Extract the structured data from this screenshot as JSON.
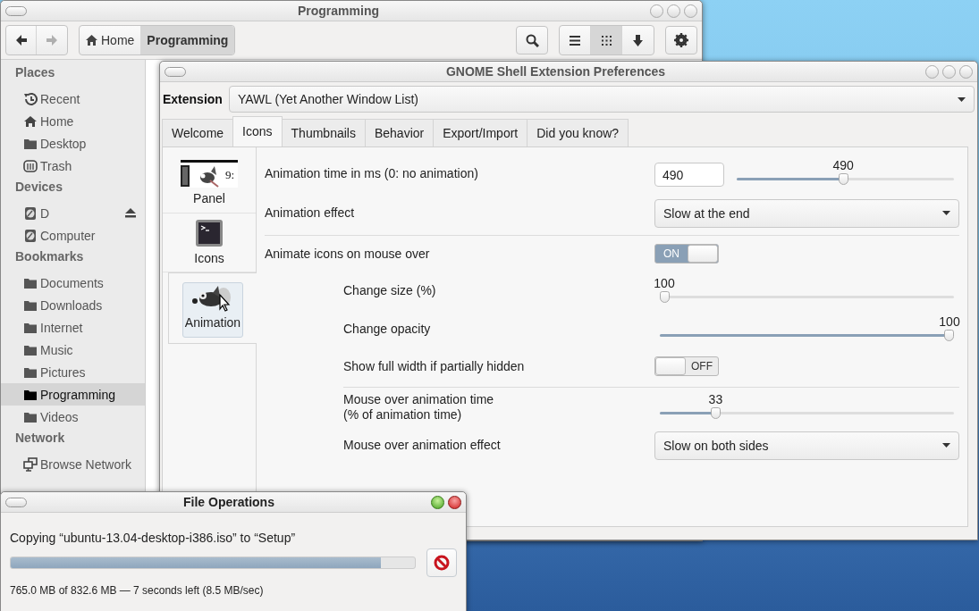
{
  "file_manager": {
    "title": "Programming",
    "nav": [
      {
        "kind": "back",
        "disabled": false
      },
      {
        "kind": "forward",
        "disabled": true
      }
    ],
    "breadcrumbs": [
      {
        "label": "Home",
        "kind": "home",
        "selected": false
      },
      {
        "label": "Programming",
        "kind": "plain",
        "selected": true
      }
    ],
    "views": [
      {
        "kind": "list",
        "selected": false
      },
      {
        "kind": "grid",
        "selected": true
      },
      {
        "kind": "sort",
        "selected": false
      }
    ],
    "sidebar": [
      {
        "heading": "Places",
        "items": [
          {
            "label": "Recent",
            "kind": "recent",
            "selected": false,
            "ejectable": false
          },
          {
            "label": "Home",
            "kind": "home",
            "selected": false,
            "ejectable": false
          },
          {
            "label": "Desktop",
            "kind": "folder",
            "selected": false,
            "ejectable": false
          },
          {
            "label": "Trash",
            "kind": "trash",
            "selected": false,
            "ejectable": false
          }
        ]
      },
      {
        "heading": "Devices",
        "items": [
          {
            "label": "D",
            "kind": "drive",
            "selected": false,
            "ejectable": true
          },
          {
            "label": "Computer",
            "kind": "drive",
            "selected": false,
            "ejectable": false
          }
        ]
      },
      {
        "heading": "Bookmarks",
        "items": [
          {
            "label": "Documents",
            "kind": "folder",
            "selected": false,
            "ejectable": false
          },
          {
            "label": "Downloads",
            "kind": "folder",
            "selected": false,
            "ejectable": false
          },
          {
            "label": "Internet",
            "kind": "folder",
            "selected": false,
            "ejectable": false
          },
          {
            "label": "Music",
            "kind": "folder",
            "selected": false,
            "ejectable": false
          },
          {
            "label": "Pictures",
            "kind": "folder",
            "selected": false,
            "ejectable": false
          },
          {
            "label": "Programming",
            "kind": "folder",
            "selected": true,
            "ejectable": false
          },
          {
            "label": "Videos",
            "kind": "folder",
            "selected": false,
            "ejectable": false
          }
        ]
      },
      {
        "heading": "Network",
        "items": [
          {
            "label": "Browse Network",
            "kind": "network",
            "selected": false,
            "ejectable": false
          }
        ]
      }
    ]
  },
  "preferences": {
    "title": "GNOME Shell Extension Preferences",
    "extension_label": "Extension",
    "extension": "YAWL (Yet Another Window List)",
    "tabs": [
      {
        "label": "Welcome",
        "selected": false
      },
      {
        "label": "Icons",
        "selected": true
      },
      {
        "label": "Thumbnails",
        "selected": false
      },
      {
        "label": "Behavior",
        "selected": false
      },
      {
        "label": "Export/Import",
        "selected": false
      },
      {
        "label": "Did you know?",
        "selected": false
      }
    ],
    "side_tabs": [
      {
        "label": "Panel",
        "kind": "panel",
        "preview_text": "9:",
        "selected": false
      },
      {
        "label": "Icons",
        "kind": "terminal",
        "selected": false
      },
      {
        "label": "Animation",
        "kind": "animation",
        "selected": true
      }
    ],
    "settings": [
      {
        "kind": "spin_slider",
        "label": "Animation time in ms (0: no animation)",
        "value": "490",
        "reading": "490",
        "level": 0.49,
        "separator_before": false
      },
      {
        "kind": "dropdown",
        "label": "Animation effect",
        "value": "Slow at the end",
        "separator_before": false
      },
      {
        "kind": "switch",
        "label": "Animate icons on mouse over",
        "on": true,
        "state_text": "ON",
        "separator_before": true,
        "children": [
          {
            "kind": "slider",
            "label": "Change size (%)",
            "reading": "100",
            "level": 0,
            "separator_before": false
          },
          {
            "kind": "slider",
            "label": "Change opacity",
            "reading": "100",
            "level": 1,
            "separator_before": false
          },
          {
            "kind": "switch",
            "label": "Show full width if partially hidden",
            "on": false,
            "state_text": "OFF",
            "separator_before": false
          },
          {
            "kind": "slider",
            "label": "Mouse over animation time\n(% of animation time)",
            "reading": "33",
            "level": 0.18,
            "separator_before": true
          },
          {
            "kind": "dropdown",
            "label": "Mouse over animation effect",
            "value": "Slow on both sides",
            "separator_before": false
          }
        ]
      }
    ]
  },
  "file_operations": {
    "title": "File Operations",
    "message": "Copying “ubuntu-13.04-desktop-i386.iso” to “Setup”",
    "level": 0.916,
    "status": "765.0 MB of 832.6 MB — 7 seconds left (8.5 MB/sec)"
  }
}
